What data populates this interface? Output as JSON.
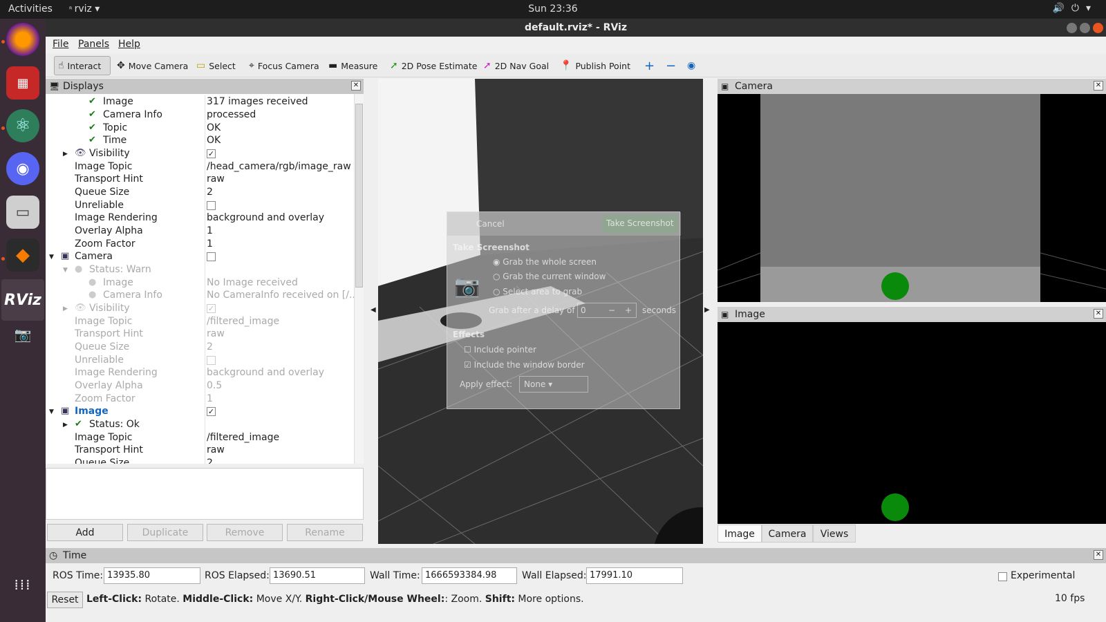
{
  "topbar": {
    "activities": "Activities",
    "app_name": "rviz",
    "clock": "Sun 23:36"
  },
  "window": {
    "title": "default.rviz* - RViz"
  },
  "menu": {
    "file": "File",
    "panels": "Panels",
    "help": "Help"
  },
  "toolbar": {
    "interact": "Interact",
    "move_camera": "Move Camera",
    "select": "Select",
    "focus_camera": "Focus Camera",
    "measure": "Measure",
    "pose_estimate": "2D Pose Estimate",
    "nav_goal": "2D Nav Goal",
    "publish_point": "Publish Point"
  },
  "displays": {
    "title": "Displays",
    "rows": [
      {
        "name": "Image",
        "value": "317 images received"
      },
      {
        "name": "Camera Info",
        "value": "processed"
      },
      {
        "name": "Topic",
        "value": "OK"
      },
      {
        "name": "Time",
        "value": "OK"
      },
      {
        "name": "Visibility",
        "value": ""
      },
      {
        "name": "Image Topic",
        "value": "/head_camera/rgb/image_raw"
      },
      {
        "name": "Transport Hint",
        "value": "raw"
      },
      {
        "name": "Queue Size",
        "value": "2"
      },
      {
        "name": "Unreliable",
        "value": ""
      },
      {
        "name": "Image Rendering",
        "value": "background and overlay"
      },
      {
        "name": "Overlay Alpha",
        "value": "1"
      },
      {
        "name": "Zoom Factor",
        "value": "1"
      },
      {
        "name": "Camera",
        "value": ""
      },
      {
        "name": "Status: Warn",
        "value": ""
      },
      {
        "name": "Image",
        "value": "No Image received"
      },
      {
        "name": "Camera Info",
        "value": "No CameraInfo received on [/..."
      },
      {
        "name": "Visibility",
        "value": ""
      },
      {
        "name": "Image Topic",
        "value": "/filtered_image"
      },
      {
        "name": "Transport Hint",
        "value": "raw"
      },
      {
        "name": "Queue Size",
        "value": "2"
      },
      {
        "name": "Unreliable",
        "value": ""
      },
      {
        "name": "Image Rendering",
        "value": "background and overlay"
      },
      {
        "name": "Overlay Alpha",
        "value": "0.5"
      },
      {
        "name": "Zoom Factor",
        "value": "1"
      },
      {
        "name": "Image",
        "value": ""
      },
      {
        "name": "Status: Ok",
        "value": ""
      },
      {
        "name": "Image Topic",
        "value": "/filtered_image"
      },
      {
        "name": "Transport Hint",
        "value": "raw"
      },
      {
        "name": "Queue Size",
        "value": "2"
      }
    ],
    "buttons": {
      "add": "Add",
      "duplicate": "Duplicate",
      "remove": "Remove",
      "rename": "Rename"
    }
  },
  "camera_panel": {
    "title": "Camera"
  },
  "image_panel": {
    "title": "Image"
  },
  "tabs": [
    "Image",
    "Camera",
    "Views"
  ],
  "screenshot_dialog": {
    "cancel": "Cancel",
    "take": "Take Screenshot",
    "heading": "Take Screenshot",
    "opt1": "Grab the whole screen",
    "opt2": "Grab the current window",
    "opt3": "Select area to grab",
    "delay_label": "Grab after a delay of",
    "delay_value": "0",
    "minus": "−",
    "plus": "+",
    "seconds": "seconds",
    "effects": "Effects",
    "pointer": "Include pointer",
    "border": "Include the window border",
    "apply": "Apply effect:",
    "effect_value": "None"
  },
  "time": {
    "title": "Time",
    "ros_time_label": "ROS Time:",
    "ros_time": "13935.80",
    "ros_elapsed_label": "ROS Elapsed:",
    "ros_elapsed": "13690.51",
    "wall_time_label": "Wall Time:",
    "wall_time": "1666593384.98",
    "wall_elapsed_label": "Wall Elapsed:",
    "wall_elapsed": "17991.10",
    "experimental": "Experimental"
  },
  "status": {
    "reset": "Reset",
    "lc": "Left-Click:",
    "lc_t": " Rotate. ",
    "mc": "Middle-Click:",
    "mc_t": " Move X/Y. ",
    "rc": "Right-Click/Mouse Wheel:",
    "rc_t": ": Zoom. ",
    "sh": "Shift:",
    "sh_t": " More options.",
    "fps": "10 fps"
  }
}
